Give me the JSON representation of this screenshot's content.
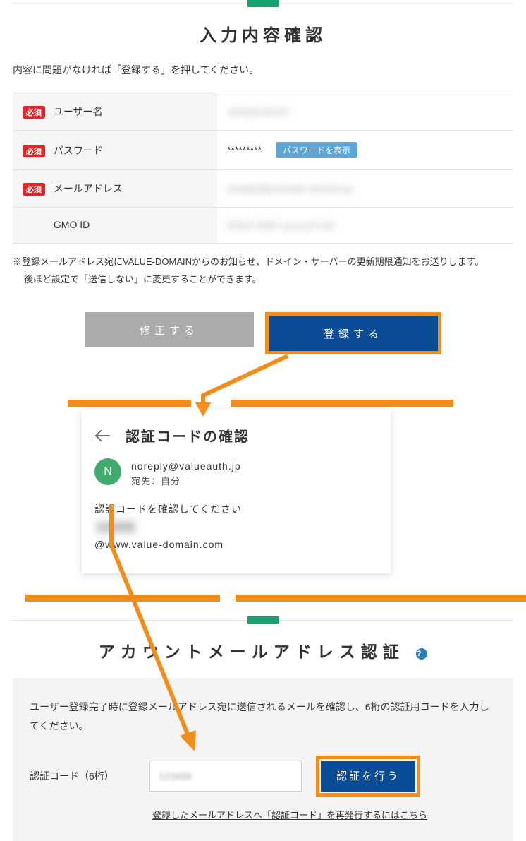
{
  "badge_required": "必須",
  "confirm": {
    "title": "入力内容確認",
    "instruction": "内容に問題がなければ「登録する」を押してください。",
    "rows": {
      "username_label": "ユーザー名",
      "username_value": "sampleuser01",
      "password_label": "パスワード",
      "password_masked": "*********",
      "show_password": "パスワードを表示",
      "email_label": "メールアドレス",
      "email_value": "sample@example-domain.jp",
      "gmoid_label": "GMO ID",
      "gmoid_value": "linked GMO account info"
    },
    "note_line1": "※登録メールアドレス宛にVALUE-DOMAINからのお知らせ、ドメイン・サーバーの更新期限通知をお送りします。",
    "note_line2": "後ほど設定で「送信しない」に変更することができます。",
    "btn_edit": "修正する",
    "btn_submit": "登録する"
  },
  "email_preview": {
    "title": "認証コードの確認",
    "avatar_letter": "N",
    "from": "noreply@valueauth.jp",
    "to_label": "宛先：",
    "to_value": "自分",
    "body_line1": "認証コードを確認してください",
    "code_masked": "123456",
    "body_line3": "@www.value-domain.com"
  },
  "auth": {
    "title": "アカウントメールアドレス認証",
    "description": "ユーザー登録完了時に登録メールアドレス宛に送信されるメールを確認し、6桁の認証用コードを入力してください。",
    "input_label": "認証コード（6桁）",
    "input_value": "123456",
    "submit": "認証を行う",
    "resend_link": "登録したメールアドレスへ「認証コード」を再発行するにはこちら"
  }
}
